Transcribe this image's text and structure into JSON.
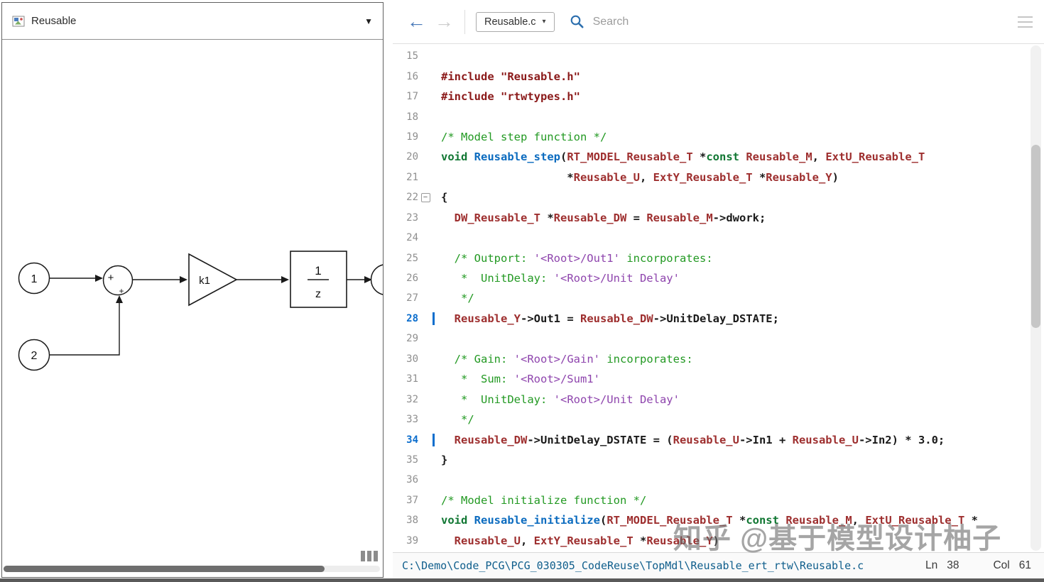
{
  "colors": {
    "accent_blue": "#0C6ECD",
    "nav_back_blue": "#4878B8",
    "search_icon_blue": "#2C6FAE",
    "comment_green": "#229922",
    "keyword_green": "#117733",
    "type_maroon": "#9E2F2F",
    "function_blue": "#0B6BBF",
    "include_red": "#8B1A1A",
    "comment_string_purple": "#8E44AD",
    "status_path_blue": "#0F5E8C"
  },
  "icons": {
    "caret_down": "▼",
    "caret_down_small": "▾",
    "back_arrow": "←",
    "forward_arrow": "→",
    "fold_collapse": "−"
  },
  "left_panel": {
    "header": {
      "title": "Reusable"
    },
    "diagram": {
      "inport1": "1",
      "inport2": "2",
      "sum_sign_left": "+",
      "sum_sign_bottom": "+",
      "gain": "k1",
      "delay_numerator": "1",
      "delay_denominator": "z"
    }
  },
  "right_panel": {
    "toolbar": {
      "file": "Reusable.c",
      "search_placeholder": "Search"
    },
    "code": {
      "lines": [
        {
          "n": 15,
          "tk": []
        },
        {
          "n": 16,
          "tk": [
            {
              "c": "inc",
              "t": "#include \"Reusable.h\""
            }
          ]
        },
        {
          "n": 17,
          "tk": [
            {
              "c": "inc",
              "t": "#include \"rtwtypes.h\""
            }
          ]
        },
        {
          "n": 18,
          "tk": []
        },
        {
          "n": 19,
          "tk": [
            {
              "c": "cm",
              "t": "/* Model step function */"
            }
          ]
        },
        {
          "n": 20,
          "tk": [
            {
              "c": "kw",
              "t": "void "
            },
            {
              "c": "fn",
              "t": "Reusable_step"
            },
            {
              "c": "pl",
              "t": "("
            },
            {
              "c": "ty",
              "t": "RT_MODEL_Reusable_T"
            },
            {
              "c": "pl",
              "t": " *"
            },
            {
              "c": "kw",
              "t": "const"
            },
            {
              "c": "pl",
              "t": " "
            },
            {
              "c": "ty",
              "t": "Reusable_M"
            },
            {
              "c": "pl",
              "t": ", "
            },
            {
              "c": "ty",
              "t": "ExtU_Reusable_T"
            }
          ]
        },
        {
          "n": 21,
          "tk": [
            {
              "c": "pl",
              "t": "                   *"
            },
            {
              "c": "ty",
              "t": "Reusable_U"
            },
            {
              "c": "pl",
              "t": ", "
            },
            {
              "c": "ty",
              "t": "ExtY_Reusable_T"
            },
            {
              "c": "pl",
              "t": " *"
            },
            {
              "c": "ty",
              "t": "Reusable_Y"
            },
            {
              "c": "pl",
              "t": ")"
            }
          ]
        },
        {
          "n": 22,
          "fold": true,
          "tk": [
            {
              "c": "pl",
              "t": "{"
            }
          ]
        },
        {
          "n": 23,
          "tk": [
            {
              "c": "pl",
              "t": "  "
            },
            {
              "c": "ty",
              "t": "DW_Reusable_T"
            },
            {
              "c": "pl",
              "t": " *"
            },
            {
              "c": "ty",
              "t": "Reusable_DW"
            },
            {
              "c": "pl",
              "t": " = "
            },
            {
              "c": "ty",
              "t": "Reusable_M"
            },
            {
              "c": "pl",
              "t": "->dwork;"
            }
          ]
        },
        {
          "n": 24,
          "tk": []
        },
        {
          "n": 25,
          "tk": [
            {
              "c": "pl",
              "t": "  "
            },
            {
              "c": "cm",
              "t": "/* Outport: "
            },
            {
              "c": "cs",
              "t": "'<Root>/Out1'"
            },
            {
              "c": "cm",
              "t": " incorporates:"
            }
          ]
        },
        {
          "n": 26,
          "tk": [
            {
              "c": "pl",
              "t": "   "
            },
            {
              "c": "cm",
              "t": "*  UnitDelay: "
            },
            {
              "c": "cs",
              "t": "'<Root>/Unit Delay'"
            }
          ]
        },
        {
          "n": 27,
          "tk": [
            {
              "c": "pl",
              "t": "   "
            },
            {
              "c": "cm",
              "t": "*/"
            }
          ]
        },
        {
          "n": 28,
          "hl": true,
          "tk": [
            {
              "c": "pl",
              "t": "  "
            },
            {
              "c": "ty",
              "t": "Reusable_Y"
            },
            {
              "c": "pl",
              "t": "->Out1 = "
            },
            {
              "c": "ty",
              "t": "Reusable_DW"
            },
            {
              "c": "pl",
              "t": "->UnitDelay_DSTATE;"
            }
          ]
        },
        {
          "n": 29,
          "tk": []
        },
        {
          "n": 30,
          "tk": [
            {
              "c": "pl",
              "t": "  "
            },
            {
              "c": "cm",
              "t": "/* Gain: "
            },
            {
              "c": "cs",
              "t": "'<Root>/Gain'"
            },
            {
              "c": "cm",
              "t": " incorporates:"
            }
          ]
        },
        {
          "n": 31,
          "tk": [
            {
              "c": "pl",
              "t": "   "
            },
            {
              "c": "cm",
              "t": "*  Sum: "
            },
            {
              "c": "cs",
              "t": "'<Root>/Sum1'"
            }
          ]
        },
        {
          "n": 32,
          "tk": [
            {
              "c": "pl",
              "t": "   "
            },
            {
              "c": "cm",
              "t": "*  UnitDelay: "
            },
            {
              "c": "cs",
              "t": "'<Root>/Unit Delay'"
            }
          ]
        },
        {
          "n": 33,
          "tk": [
            {
              "c": "pl",
              "t": "   "
            },
            {
              "c": "cm",
              "t": "*/"
            }
          ]
        },
        {
          "n": 34,
          "hl": true,
          "tk": [
            {
              "c": "pl",
              "t": "  "
            },
            {
              "c": "ty",
              "t": "Reusable_DW"
            },
            {
              "c": "pl",
              "t": "->UnitDelay_DSTATE = ("
            },
            {
              "c": "ty",
              "t": "Reusable_U"
            },
            {
              "c": "pl",
              "t": "->In1 + "
            },
            {
              "c": "ty",
              "t": "Reusable_U"
            },
            {
              "c": "pl",
              "t": "->In2) * 3.0;"
            }
          ]
        },
        {
          "n": 35,
          "tk": [
            {
              "c": "pl",
              "t": "}"
            }
          ]
        },
        {
          "n": 36,
          "tk": []
        },
        {
          "n": 37,
          "tk": [
            {
              "c": "cm",
              "t": "/* Model initialize function */"
            }
          ]
        },
        {
          "n": 38,
          "tk": [
            {
              "c": "kw",
              "t": "void "
            },
            {
              "c": "fn",
              "t": "Reusable_initialize"
            },
            {
              "c": "pl",
              "t": "("
            },
            {
              "c": "ty",
              "t": "RT_MODEL_Reusable_T"
            },
            {
              "c": "pl",
              "t": " *"
            },
            {
              "c": "kw",
              "t": "const"
            },
            {
              "c": "pl",
              "t": " "
            },
            {
              "c": "ty",
              "t": "Reusable_M"
            },
            {
              "c": "pl",
              "t": ", "
            },
            {
              "c": "ty",
              "t": "ExtU_Reusable_T"
            },
            {
              "c": "pl",
              "t": " *"
            }
          ]
        },
        {
          "n": 39,
          "tk": [
            {
              "c": "pl",
              "t": "  "
            },
            {
              "c": "ty",
              "t": "Reusable_U"
            },
            {
              "c": "pl",
              "t": ", "
            },
            {
              "c": "ty",
              "t": "ExtY_Reusable_T"
            },
            {
              "c": "pl",
              "t": " *"
            },
            {
              "c": "ty",
              "t": "Reusable_Y"
            },
            {
              "c": "pl",
              "t": ")"
            }
          ]
        }
      ]
    },
    "status": {
      "path": "C:\\Demo\\Code_PCG\\PCG_030305_CodeReuse\\TopMdl\\Reusable_ert_rtw\\Reusable.c",
      "ln_label": "Ln",
      "ln_value": "38",
      "col_label": "Col",
      "col_value": "61"
    }
  },
  "watermark": "知乎 @基于模型设计柚子"
}
